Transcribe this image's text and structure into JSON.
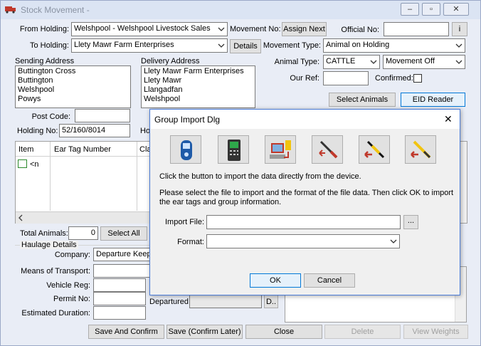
{
  "window": {
    "title": "Stock Movement -",
    "minimize": "‒",
    "restore": "▫",
    "close": "✕"
  },
  "form": {
    "from_holding_label": "From Holding:",
    "from_holding_value": "Welshpool - Welshpool Livestock Sales",
    "to_holding_label": "To Holding:",
    "to_holding_value": "Llety Mawr Farm Enterprises",
    "movement_no_label": "Movement No:",
    "assign_next": "Assign Next",
    "official_no_label": "Official No:",
    "official_btn": "i",
    "details_btn": "Details",
    "movement_type_label": "Movement Type:",
    "movement_type_value": "Animal on Holding",
    "animal_type_label": "Animal Type:",
    "animal_type_value": "CATTLE",
    "movement_off_value": "Movement Off",
    "our_ref_label": "Our Ref:",
    "confirmed_label": "Confirmed:",
    "select_animals": "Select Animals",
    "eid_reader": "EID Reader",
    "sending_address_label": "Sending Address",
    "sending_address_lines": [
      "Buttington Cross",
      "Buttington",
      "Welshpool",
      "Powys"
    ],
    "delivery_address_label": "Delivery Address",
    "delivery_address_lines": [
      "Llety Mawr Farm Enterprises",
      "Llety Mawr",
      "Llangadfan",
      "Welshpool"
    ],
    "post_code_label": "Post Code:",
    "holding_no_label": "Holding No:",
    "holding_no_value": "52/160/8014",
    "holding_partial_label": "Ho",
    "grid_col_item": "Item",
    "grid_col_ear_tag": "Ear Tag Number",
    "grid_col_cla": "Cla",
    "grid_new_row": "<n",
    "total_animals_label": "Total Animals:",
    "total_animals_value": "0",
    "select_all": "Select All",
    "haulage_details_label": "Haulage Details",
    "company_label": "Company:",
    "company_value": "Departure Keepe",
    "means_of_transport_label": "Means of Transport:",
    "vehicle_reg_label": "Vehicle Reg:",
    "permit_no_label": "Permit No:",
    "departured_label": "Departured:",
    "departured_btn": "D..",
    "estimated_duration_label": "Estimated Duration:"
  },
  "bottom_buttons": {
    "save_confirm": "Save And Confirm",
    "save_later": "Save (Confirm Later)",
    "close": "Close",
    "delete": "Delete",
    "view_weights": "View Weights"
  },
  "dialog": {
    "title": "Group Import Dlg",
    "close": "✕",
    "device_icons": [
      "rfid-reader-icon",
      "handheld-terminal-icon",
      "computer-import-icon",
      "wand-reader-red-icon",
      "wand-reader-yellow-icon",
      "wand-reader-yellow2-icon"
    ],
    "instruction1": "Click the  button to import the data directly from the device.",
    "instruction2": "Please select the file to import and the format of the file data. Then click OK to import the ear tags and group information.",
    "import_file_label": "Import File:",
    "browse_btn": "...",
    "format_label": "Format:",
    "ok": "OK",
    "cancel": "Cancel"
  },
  "colors": {
    "accent": "#0078d7",
    "title_inactive": "#8a93a3"
  }
}
